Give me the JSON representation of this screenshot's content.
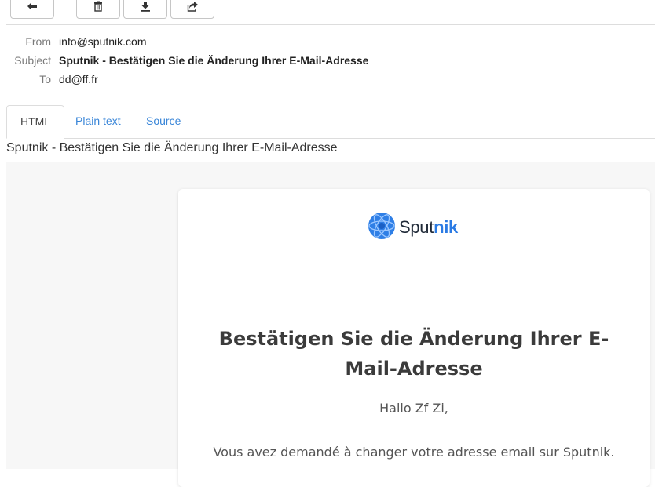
{
  "toolbar": {
    "buttons": [
      {
        "name": "back-button",
        "icon": "arrow-left-icon"
      },
      {
        "name": "delete-button",
        "icon": "trash-icon"
      },
      {
        "name": "download-button",
        "icon": "download-icon"
      },
      {
        "name": "forward-button",
        "icon": "share-icon"
      }
    ]
  },
  "headers": {
    "from_label": "From",
    "from_value": "info@sputnik.com",
    "subject_label": "Subject",
    "subject_value": "Sputnik - Bestätigen Sie die Änderung Ihrer E-Mail-Adresse",
    "to_label": "To",
    "to_value": "dd@ff.fr"
  },
  "tabs": [
    {
      "label": "HTML",
      "active": true
    },
    {
      "label": "Plain text",
      "active": false
    },
    {
      "label": "Source",
      "active": false
    }
  ],
  "email": {
    "title_line": "Sputnik - Bestätigen Sie die Änderung Ihrer E-Mail-Adresse",
    "logo_part1": "Sput",
    "logo_part2": "nik",
    "headline": "Bestätigen Sie die Änderung Ihrer E-Mail-Adresse",
    "greeting": "Hallo Zf Zi,",
    "body": "Vous avez demandé à changer votre adresse email sur Sputnik."
  },
  "colors": {
    "link": "#3a86d8",
    "brand_blue": "#2b7be4",
    "card_bg": "#ffffff",
    "mail_bg": "#f7f7f7"
  }
}
